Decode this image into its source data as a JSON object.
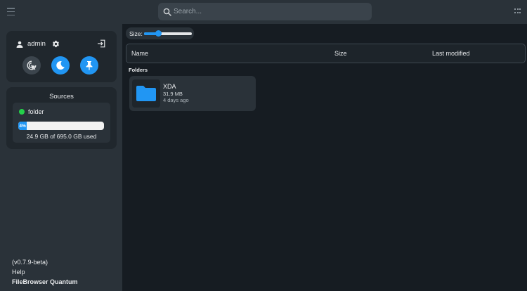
{
  "topbar": {
    "search_placeholder": "Search..."
  },
  "sidebar": {
    "user": {
      "name": "admin"
    },
    "sources": {
      "title": "Sources",
      "items": [
        {
          "name": "folder",
          "status_color": "#24d14a",
          "usage_percent": 4,
          "usage_label": "4%",
          "usage_text": "24.9 GB of 695.0 GB used"
        }
      ]
    },
    "footer": {
      "version": "(v0.7.9-beta)",
      "help": "Help",
      "brand": "FileBrowser Quantum"
    }
  },
  "main": {
    "size_label": "Size:",
    "size_slider_value": 0.3,
    "columns": {
      "name": "Name",
      "size": "Size",
      "modified": "Last modified"
    },
    "sections": [
      {
        "label": "Folders",
        "items": [
          {
            "name": "XDA",
            "size": "31.9 MB",
            "modified": "4 days ago",
            "icon": "folder-icon"
          }
        ]
      }
    ]
  },
  "colors": {
    "accent": "#2196f3",
    "background": "#161c22",
    "sidebar": "#2a3239",
    "online": "#24d14a"
  }
}
